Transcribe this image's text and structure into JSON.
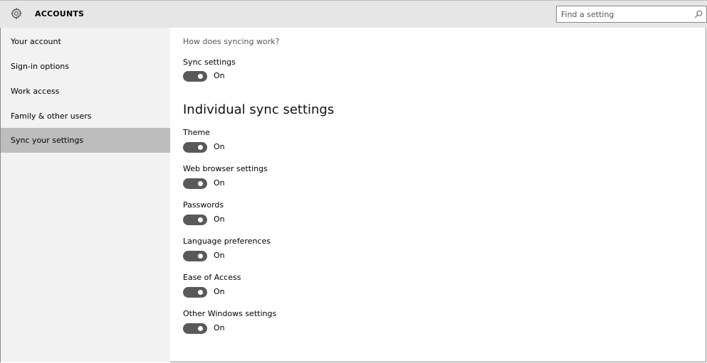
{
  "header": {
    "title": "ACCOUNTS",
    "search": {
      "placeholder": "Find a setting",
      "value": ""
    }
  },
  "sidebar": {
    "items": [
      {
        "label": "Your account"
      },
      {
        "label": "Sign-in options"
      },
      {
        "label": "Work access"
      },
      {
        "label": "Family & other users"
      },
      {
        "label": "Sync your settings"
      }
    ],
    "active": "Sync your settings"
  },
  "main": {
    "help_link": "How does syncing work?",
    "sync_settings": {
      "label": "Sync settings",
      "state": "On"
    },
    "section_title": "Individual sync settings",
    "toggles": [
      {
        "label": "Theme",
        "state": "On"
      },
      {
        "label": "Web browser settings",
        "state": "On"
      },
      {
        "label": "Passwords",
        "state": "On"
      },
      {
        "label": "Language preferences",
        "state": "On"
      },
      {
        "label": "Ease of Access",
        "state": "On"
      },
      {
        "label": "Other Windows settings",
        "state": "On"
      }
    ]
  },
  "colors": {
    "header_bg": "#e6e6e6",
    "sidebar_bg": "#f2f2f2",
    "active_item_bg": "#bdbdbd",
    "toggle_on": "#595959"
  },
  "icons": {
    "app": "gear-icon",
    "search": "search-icon"
  }
}
